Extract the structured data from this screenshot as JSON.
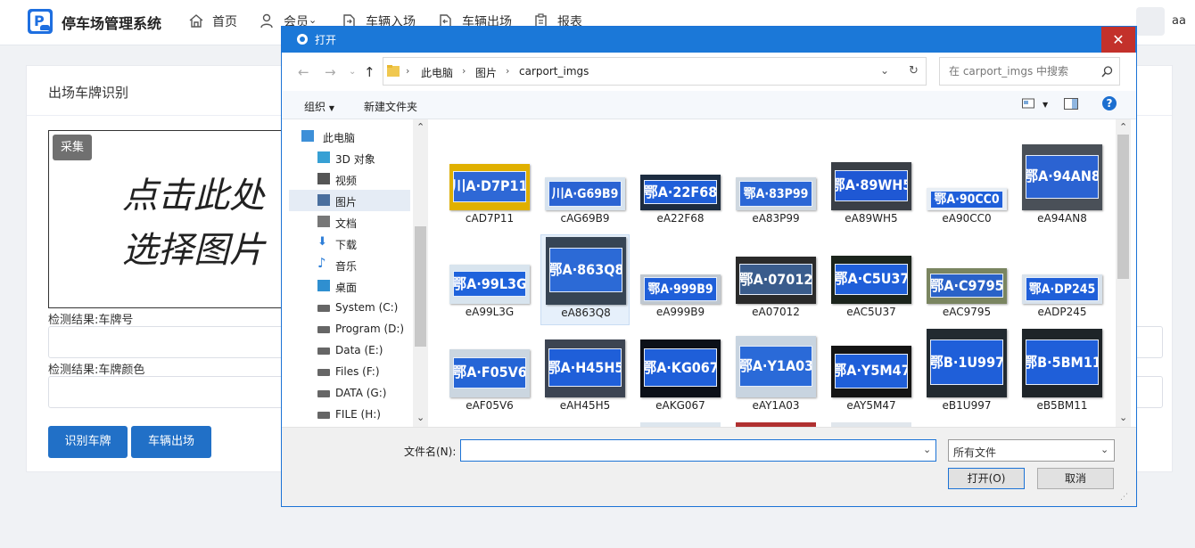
{
  "app": {
    "brand": "停车场管理系统",
    "user": "aa"
  },
  "nav": {
    "items": [
      {
        "label": "首页"
      },
      {
        "label": "会员"
      },
      {
        "label": "车辆入场"
      },
      {
        "label": "车辆出场"
      },
      {
        "label": "报表"
      }
    ]
  },
  "card": {
    "title": "出场车牌识别",
    "tag": "采集",
    "hint_line1": "点击此处",
    "hint_line2": "选择图片",
    "label_plate": "检测结果:车牌号",
    "label_color": "检测结果:车牌颜色",
    "btn_recognize": "识别车牌",
    "btn_exit": "车辆出场"
  },
  "dialog": {
    "title": "打开",
    "path": [
      "此电脑",
      "图片",
      "carport_imgs"
    ],
    "search_placeholder": "在 carport_imgs 中搜索",
    "toolbar": {
      "organize": "组织",
      "new_folder": "新建文件夹"
    },
    "sidebar": [
      "此电脑",
      "3D 对象",
      "视频",
      "图片",
      "文档",
      "下载",
      "音乐",
      "桌面",
      "System (C:)",
      "Program (D:)",
      "Data (E:)",
      "Files (F:)",
      "DATA (G:)",
      "FILE (H:)"
    ],
    "files": [
      {
        "name": "cAD7P11",
        "plate": "川A·D7P11",
        "bg": "#e0b000",
        "pc": "#2e68d6"
      },
      {
        "name": "cAG69B9",
        "plate": "川A·G69B9",
        "bg": "#d7e3ee",
        "pc": "#2a63d3"
      },
      {
        "name": "eA22F68",
        "plate": "鄂A·22F68",
        "bg": "#1c2c40",
        "pc": "#1f5fd9"
      },
      {
        "name": "eA83P99",
        "plate": "鄂A·83P99",
        "bg": "#cfd8e0",
        "pc": "#2a66d6"
      },
      {
        "name": "eA89WH5",
        "plate": "鄂A·89WH5",
        "bg": "#3a3f46",
        "pc": "#1f58d4"
      },
      {
        "name": "eA90CC0",
        "plate": "鄂A·90CC0",
        "bg": "#e8eef4",
        "pc": "#1f5fd9"
      },
      {
        "name": "eA94AN8",
        "plate": "鄂A·94AN8",
        "bg": "#4a5058",
        "pc": "#2b63d2"
      },
      {
        "name": "eA99L3G",
        "plate": "鄂A·99L3G",
        "bg": "#d8e4ee",
        "pc": "#1f63dc"
      },
      {
        "name": "eA863Q8",
        "plate": "鄂A·863Q8",
        "bg": "#364454",
        "pc": "#2c6ad6"
      },
      {
        "name": "eA999B9",
        "plate": "鄂A·999B9",
        "bg": "#c0c8d0",
        "pc": "#1f5fd9"
      },
      {
        "name": "eA07012",
        "plate": "鄂A·07012",
        "bg": "#2a2a2a",
        "pc": "#3a5c8c"
      },
      {
        "name": "eAC5U37",
        "plate": "鄂A·C5U37",
        "bg": "#1b241c",
        "pc": "#1f5fd9"
      },
      {
        "name": "eAC9795",
        "plate": "鄂A·C9795",
        "bg": "#7a8560",
        "pc": "#2a62c8"
      },
      {
        "name": "eADP245",
        "plate": "鄂A·DP245",
        "bg": "#d8e2ec",
        "pc": "#1f5fd9"
      },
      {
        "name": "eAF05V6",
        "plate": "鄂A·F05V6",
        "bg": "#cbd6e0",
        "pc": "#2565d6"
      },
      {
        "name": "eAH45H5",
        "plate": "鄂A·H45H5",
        "bg": "#3c4452",
        "pc": "#1f5fd9"
      },
      {
        "name": "eAKG067",
        "plate": "鄂A·KG067",
        "bg": "#0c1018",
        "pc": "#1f5fd9"
      },
      {
        "name": "eAY1A03",
        "plate": "鄂A·Y1A03",
        "bg": "#c8d4e0",
        "pc": "#2a6ad8"
      },
      {
        "name": "eAY5M47",
        "plate": "鄂A·Y5M47",
        "bg": "#141414",
        "pc": "#1f5fd9"
      },
      {
        "name": "eB1U997",
        "plate": "鄂B·1U997",
        "bg": "#222a30",
        "pc": "#1f5fd9"
      },
      {
        "name": "eB5BM11",
        "plate": "鄂B·5BM11",
        "bg": "#1e2428",
        "pc": "#1f5fd9"
      }
    ],
    "filename_label": "文件名(N):",
    "filename_value": "",
    "filetype": "所有文件",
    "btn_open": "打开(O)",
    "btn_cancel": "取消"
  }
}
